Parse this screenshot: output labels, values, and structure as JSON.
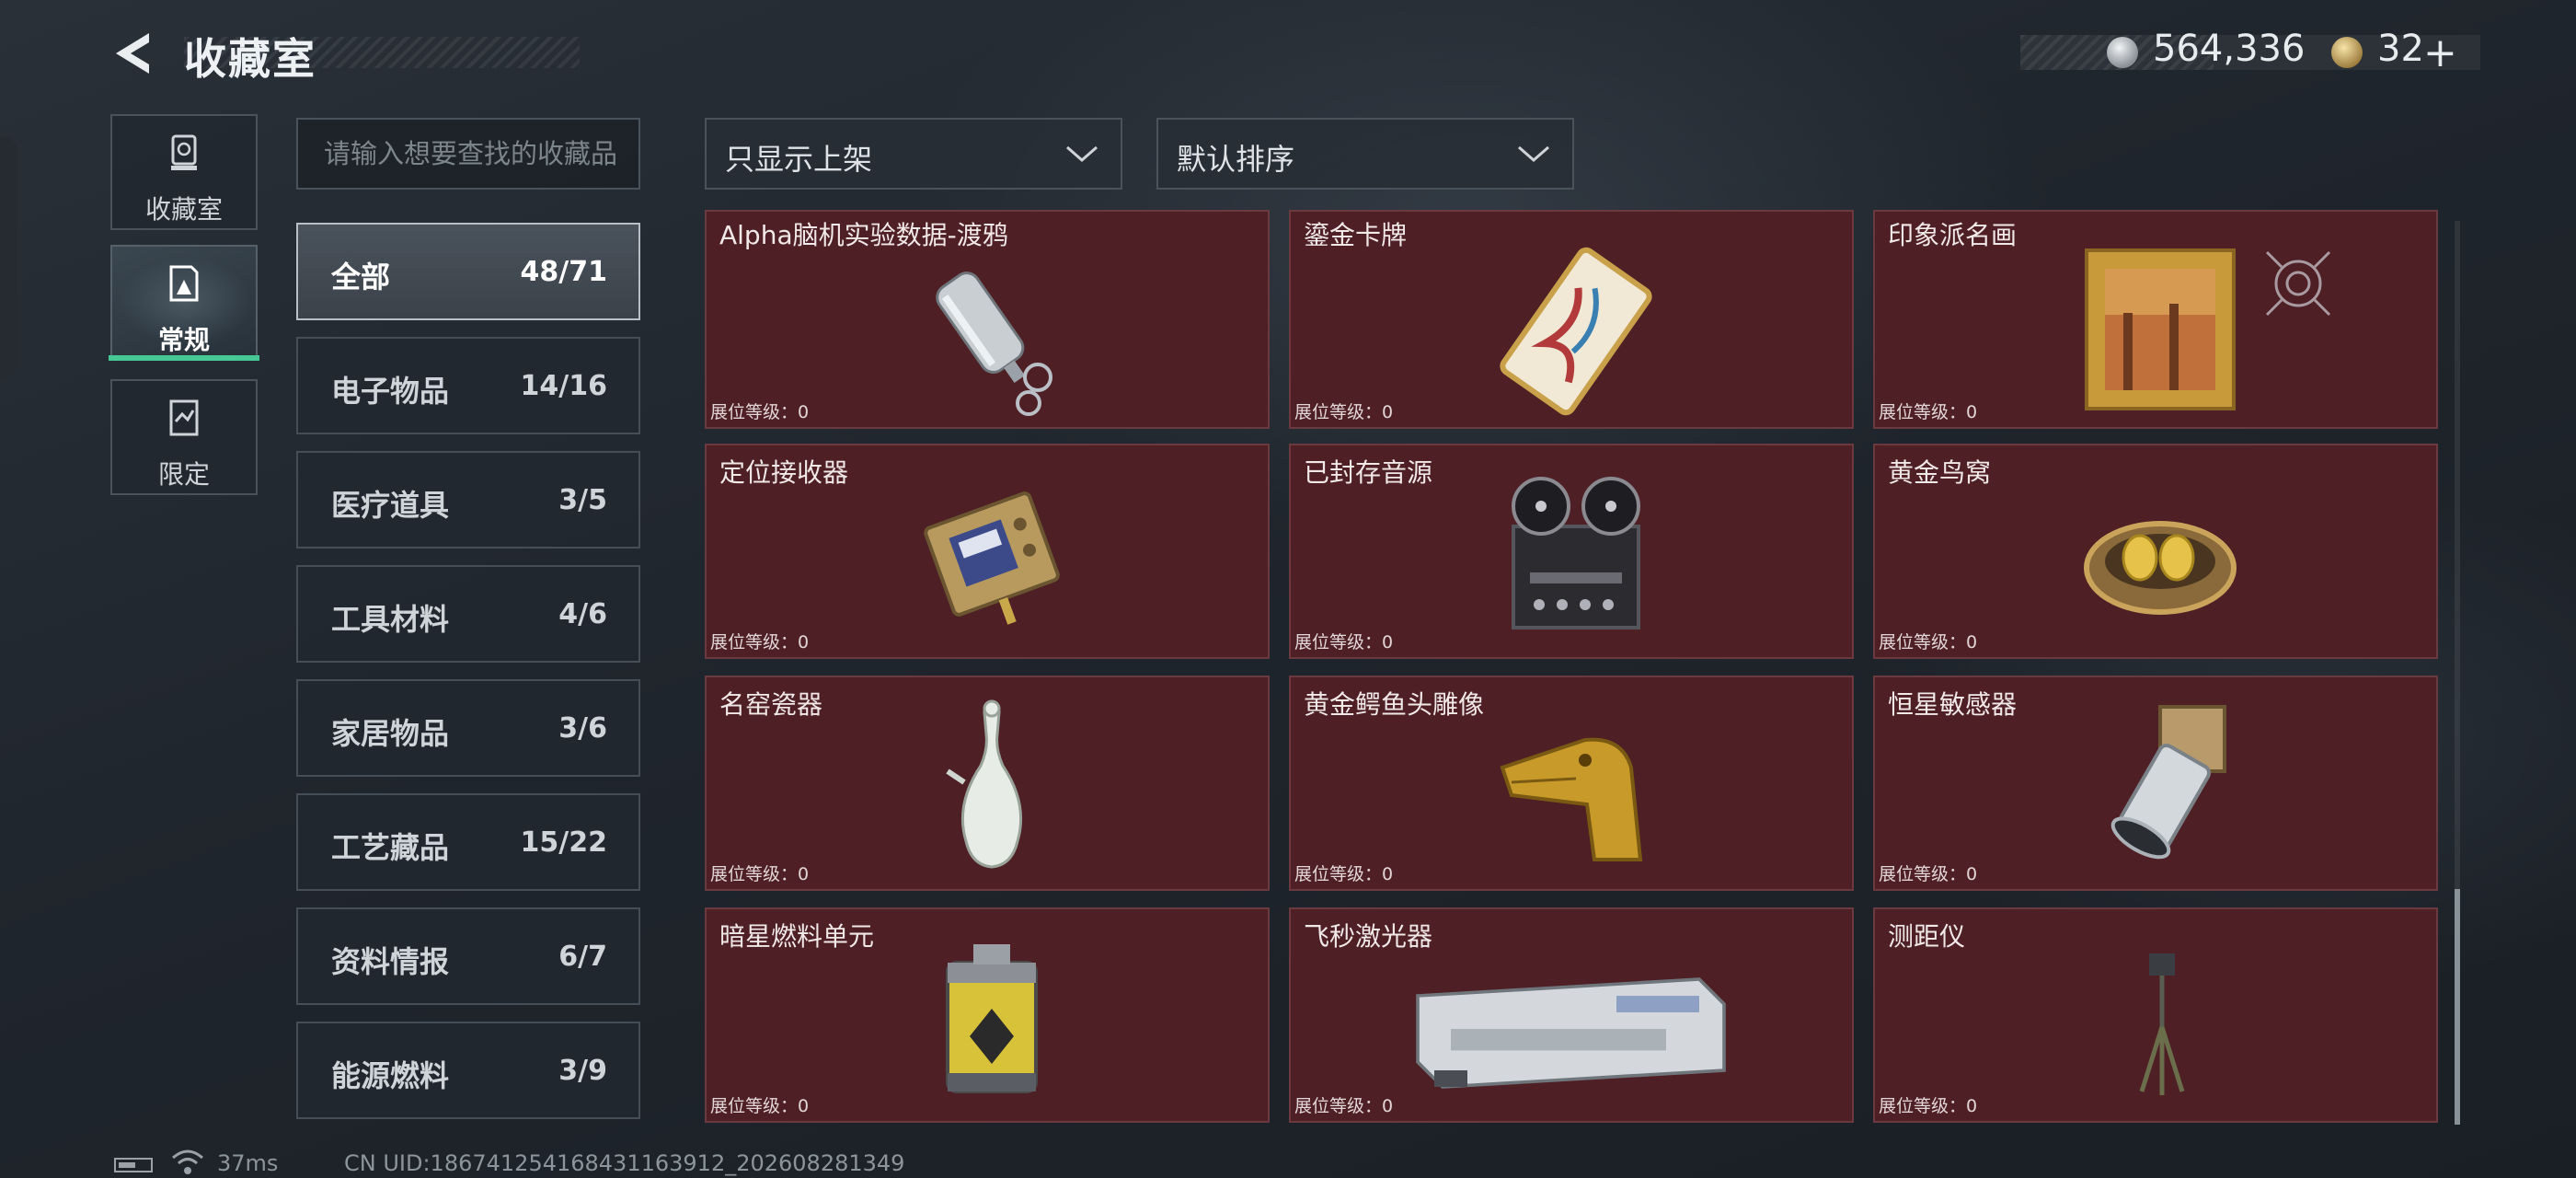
{
  "header": {
    "title": "收藏室",
    "coin_value": "564,336",
    "gold_value": "32",
    "plus_symbol": "+"
  },
  "nav": [
    {
      "label": "收藏室",
      "icon": "trophy-icon"
    },
    {
      "label": "常规",
      "icon": "regular-collection-icon",
      "active": true
    },
    {
      "label": "限定",
      "icon": "limited-collection-icon"
    }
  ],
  "search": {
    "placeholder": "请输入想要查找的收藏品"
  },
  "filters": {
    "display_filter": "只显示上架",
    "sort_order": "默认排序"
  },
  "categories": [
    {
      "name": "全部",
      "count": "48/71",
      "active": true
    },
    {
      "name": "电子物品",
      "count": "14/16"
    },
    {
      "name": "医疗道具",
      "count": "3/5"
    },
    {
      "name": "工具材料",
      "count": "4/6"
    },
    {
      "name": "家居物品",
      "count": "3/6"
    },
    {
      "name": "工艺藏品",
      "count": "15/22"
    },
    {
      "name": "资料情报",
      "count": "6/7"
    },
    {
      "name": "能源燃料",
      "count": "3/9"
    }
  ],
  "items": [
    {
      "name": "Alpha脑机实验数据-渡鸦",
      "level": "展位等级：0",
      "icon": "usb-keychain-icon"
    },
    {
      "name": "鎏金卡牌",
      "level": "展位等级：0",
      "icon": "gilded-card-icon"
    },
    {
      "name": "印象派名画",
      "level": "展位等级：0",
      "icon": "framed-painting-icon"
    },
    {
      "name": "定位接收器",
      "level": "展位等级：0",
      "icon": "locator-receiver-icon"
    },
    {
      "name": "已封存音源",
      "level": "展位等级：0",
      "icon": "reel-recorder-icon"
    },
    {
      "name": "黄金鸟窝",
      "level": "展位等级：0",
      "icon": "golden-nest-icon"
    },
    {
      "name": "名窑瓷器",
      "level": "展位等级：0",
      "icon": "porcelain-vase-icon"
    },
    {
      "name": "黄金鳄鱼头雕像",
      "level": "展位等级：0",
      "icon": "gold-crocodile-head-icon"
    },
    {
      "name": "恒星敏感器",
      "level": "展位等级：0",
      "icon": "star-sensor-icon"
    },
    {
      "name": "暗星燃料单元",
      "level": "展位等级：0",
      "icon": "fuel-cell-icon"
    },
    {
      "name": "飞秒激光器",
      "level": "展位等级：0",
      "icon": "laser-device-icon"
    },
    {
      "name": "测距仪",
      "level": "展位等级：0",
      "icon": "rangefinder-tripod-icon"
    }
  ],
  "footer": {
    "ping": "37ms",
    "uid": "CN UID:1867412541684311639​12_202608281349"
  },
  "colors": {
    "card_bg": "#4e1f25",
    "accent_green": "#45c896"
  }
}
